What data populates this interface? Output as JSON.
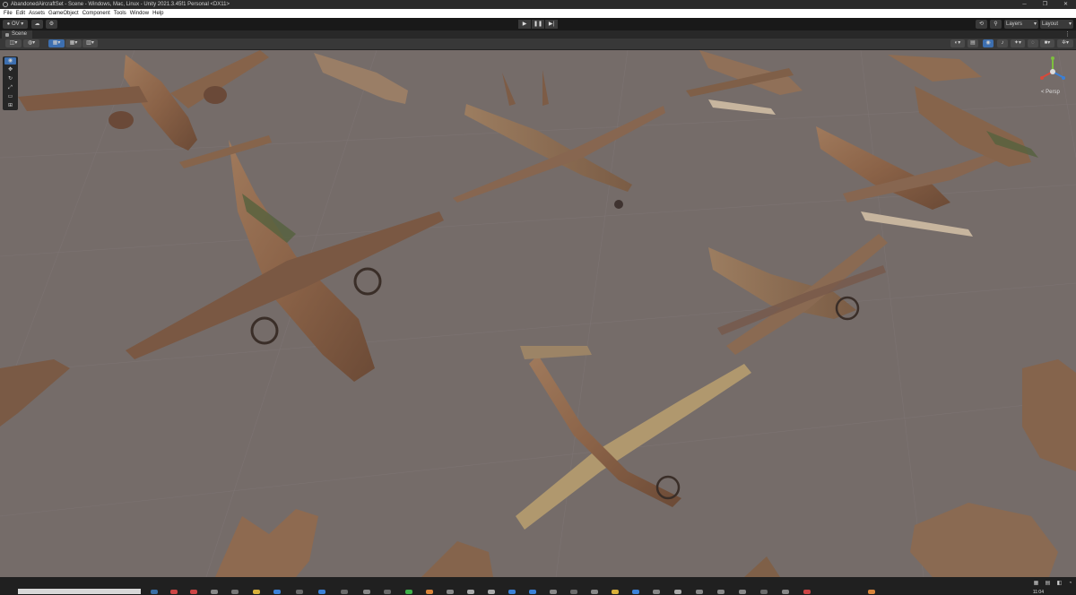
{
  "window": {
    "title": "AbandonedAircraftSet - Scene - Windows, Mac, Linux - Unity 2021.3.45f1 Personal <DX11>",
    "minimize": "─",
    "maximize": "❐",
    "close": "✕"
  },
  "menu": [
    "File",
    "Edit",
    "Assets",
    "GameObject",
    "Component",
    "Tools",
    "Window",
    "Help"
  ],
  "toolbar": {
    "account_label": "OV",
    "cloud_icon": "cloud-icon",
    "settings_icon": "gear-icon",
    "play": "▶",
    "pause": "❚❚",
    "step": "▶|",
    "history_icon": "history-icon",
    "search_icon": "search-icon",
    "layers_label": "Layers",
    "layout_label": "Layout"
  },
  "scene_tab": {
    "label": "Scene",
    "menu": "⋮"
  },
  "scene_view": {
    "projection_label": "< Persp",
    "background_color": "#756c69",
    "aircraft_color": "#8e6a50"
  },
  "tools": [
    "view-tool",
    "move-tool",
    "rotate-tool",
    "scale-tool",
    "rect-tool",
    "transform-tool"
  ],
  "taskbar": {
    "time": "11:04"
  }
}
